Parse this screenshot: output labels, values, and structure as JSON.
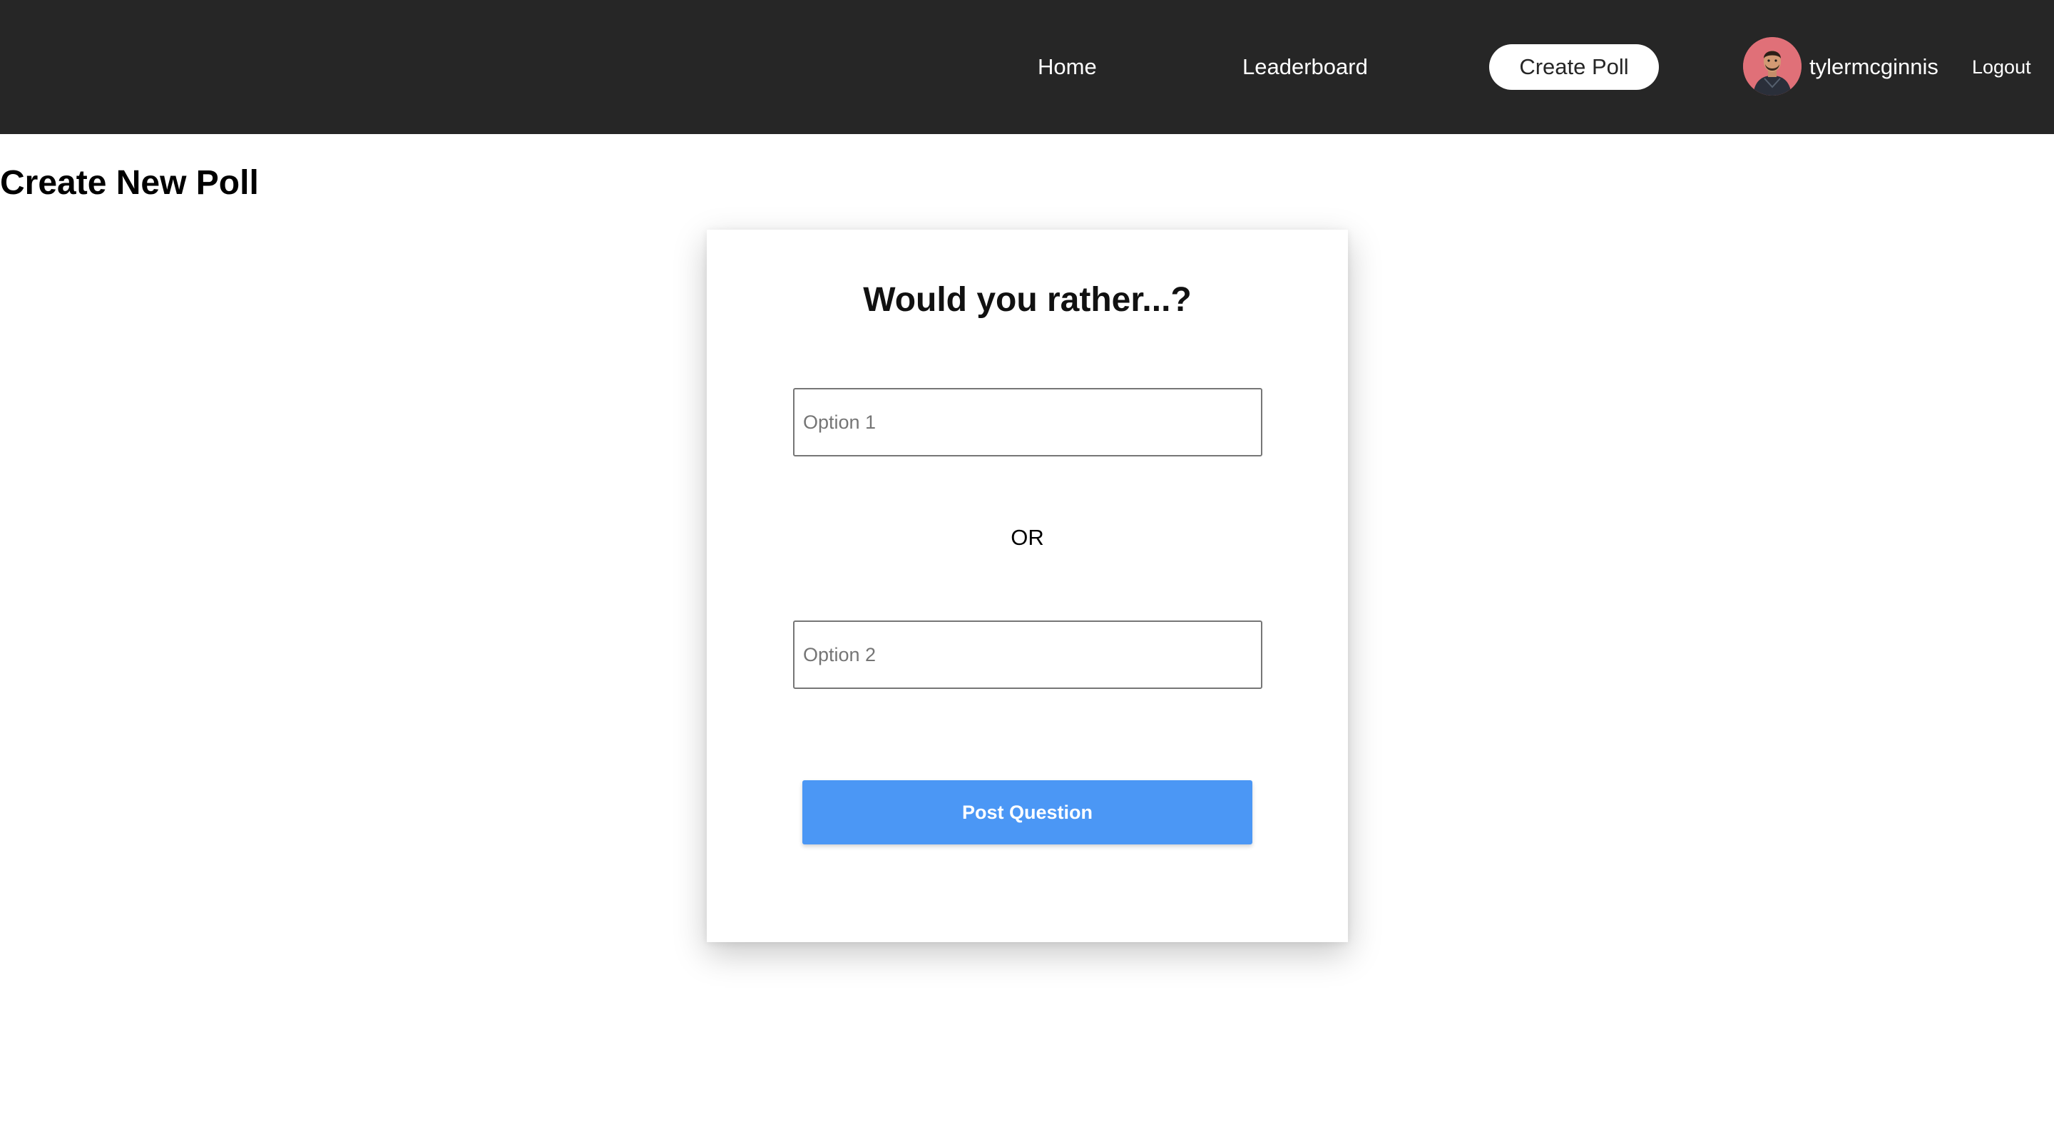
{
  "nav": {
    "home_label": "Home",
    "leaderboard_label": "Leaderboard",
    "create_poll_label": "Create Poll",
    "username": "tylermcginnis",
    "logout_label": "Logout",
    "avatar_icon": "user-avatar-photo"
  },
  "page": {
    "title": "Create New Poll"
  },
  "poll_form": {
    "heading": "Would you rather...?",
    "option1": {
      "placeholder": "Option 1",
      "value": ""
    },
    "separator": "OR",
    "option2": {
      "placeholder": "Option 2",
      "value": ""
    },
    "submit_label": "Post Question"
  },
  "colors": {
    "navbar_bg": "#262626",
    "accent_button": "#4b97f5",
    "avatar_bg": "#e07078"
  }
}
